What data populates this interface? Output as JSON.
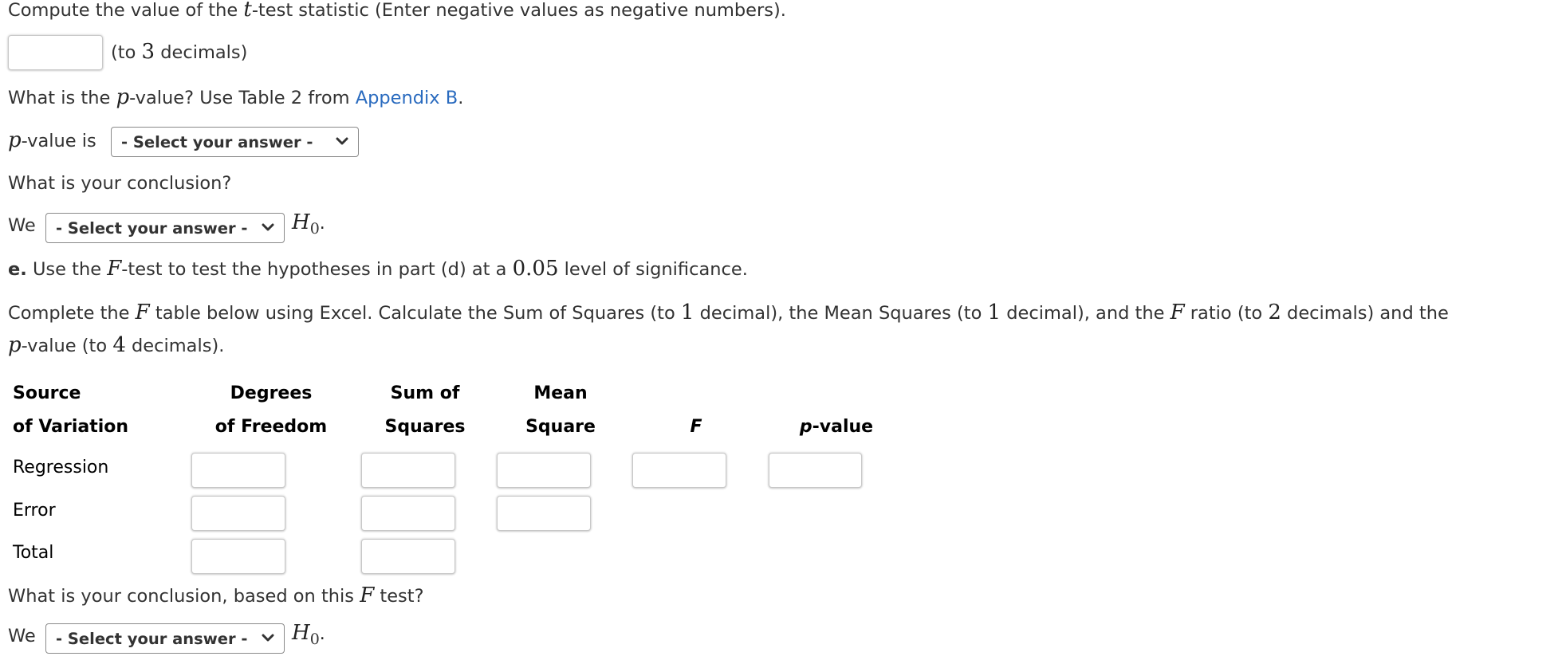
{
  "question_t": {
    "prompt_prefix": "Compute the value of the ",
    "prompt_var": "t",
    "prompt_suffix": "-test statistic (Enter negative values as negative numbers).",
    "input_value": "",
    "hint_prefix": "(to ",
    "hint_num": "3",
    "hint_suffix": " decimals)"
  },
  "question_pvalue": {
    "prompt_prefix": "What is the ",
    "prompt_var": "p",
    "prompt_mid": "-value? Use Table 2 from ",
    "link_text": "Appendix B",
    "prompt_end": ".",
    "label_var": "p",
    "label_suffix": "-value is",
    "select_value": "- Select your answer -"
  },
  "question_conclusion_t": {
    "prompt": "What is your conclusion?",
    "we_label": "We",
    "select_value": "- Select your answer -",
    "h0_main": "H",
    "h0_sub": "0",
    "h0_end": "."
  },
  "part_e": {
    "letter": "e.",
    "text_a": " Use the ",
    "var": "F",
    "text_b": "-test to test the hypotheses in part (d) at a ",
    "alpha": "0.05",
    "text_c": " level of significance."
  },
  "instructions": {
    "line1": [
      {
        "t": "text",
        "v": "Complete the "
      },
      {
        "t": "math",
        "v": "F"
      },
      {
        "t": "text",
        "v": " table below using Excel. Calculate the Sum of Squares (to "
      },
      {
        "t": "num",
        "v": "1"
      },
      {
        "t": "text",
        "v": " decimal), the Mean Squares (to "
      },
      {
        "t": "num",
        "v": "1"
      },
      {
        "t": "text",
        "v": " decimal), and the "
      },
      {
        "t": "math",
        "v": "F"
      },
      {
        "t": "text",
        "v": " ratio (to "
      },
      {
        "t": "num",
        "v": "2"
      },
      {
        "t": "text",
        "v": " decimals) and the"
      }
    ],
    "line2_var": "p",
    "line2_a": "-value (to ",
    "line2_num": "4",
    "line2_b": " decimals)."
  },
  "anova_table": {
    "headers": {
      "source": [
        "Source",
        "of Variation"
      ],
      "df": [
        "Degrees",
        "of Freedom"
      ],
      "ss": [
        "Sum of",
        "Squares"
      ],
      "ms": [
        "Mean",
        "Square"
      ],
      "f": "F",
      "p_var": "p",
      "p_suffix": "-value"
    },
    "rows": [
      {
        "label": "Regression",
        "df": "",
        "ss": "",
        "ms": "",
        "f": "",
        "p": ""
      },
      {
        "label": "Error",
        "df": "",
        "ss": "",
        "ms": ""
      },
      {
        "label": "Total",
        "df": "",
        "ss": ""
      }
    ]
  },
  "question_conclusion_f": {
    "prompt_a": "What is your conclusion, based on this ",
    "var": "F",
    "prompt_b": " test?",
    "we_label": "We",
    "select_value": "- Select your answer -",
    "h0_main": "H",
    "h0_sub": "0",
    "h0_end": "."
  },
  "colors": {
    "text": "#333333",
    "link": "#2a6bbf",
    "table_text": "#000000",
    "input_border": "#c8c8c8",
    "select_border": "#8a8a8a"
  }
}
